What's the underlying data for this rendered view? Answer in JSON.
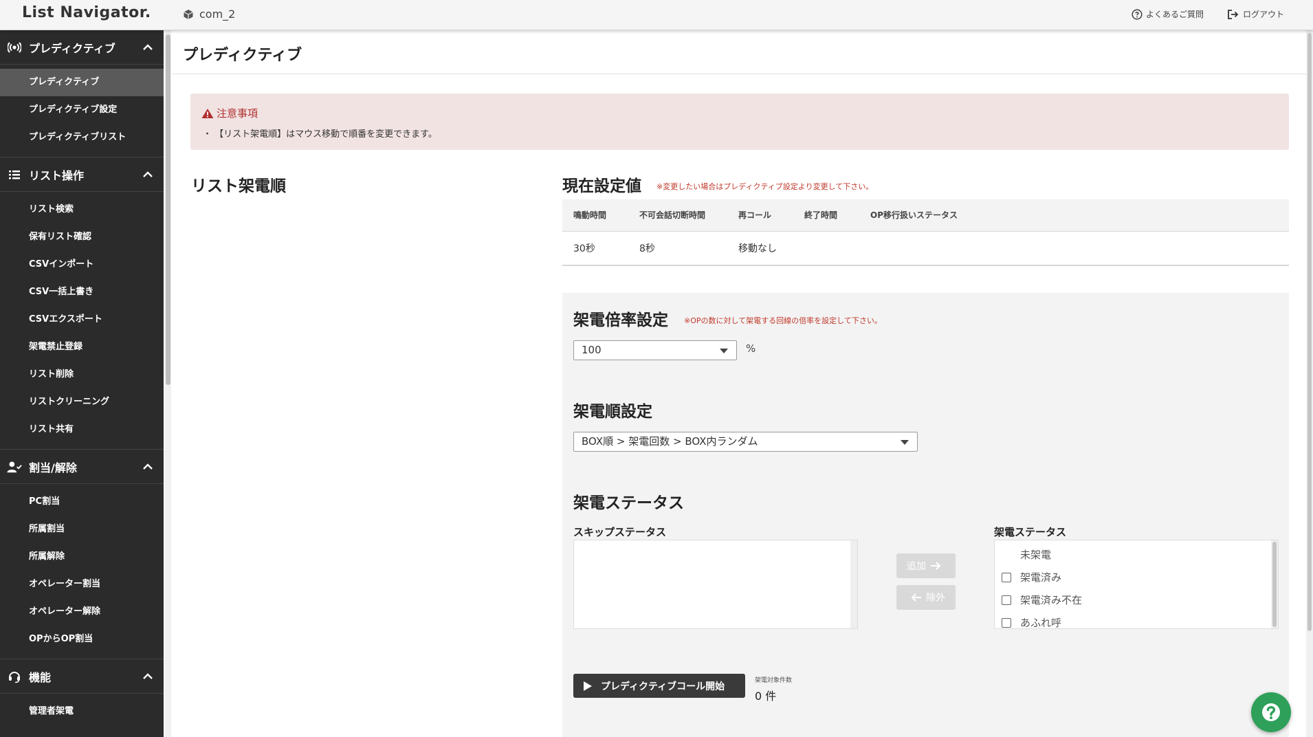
{
  "header": {
    "logo": "List Navigator.",
    "company": "com_2",
    "faq_label": "よくあるご質問",
    "logout_label": "ログアウト"
  },
  "sidebar": {
    "sections": [
      {
        "title": "プレディクティブ",
        "icon": "broadcast-icon",
        "items": [
          "プレディクティブ",
          "プレディクティブ設定",
          "プレディクティブリスト"
        ]
      },
      {
        "title": "リスト操作",
        "icon": "list-icon",
        "items": [
          "リスト検索",
          "保有リスト確認",
          "CSVインポート",
          "CSV一括上書き",
          "CSVエクスポート",
          "架電禁止登録",
          "リスト削除",
          "リストクリーニング",
          "リスト共有"
        ]
      },
      {
        "title": "割当/解除",
        "icon": "user-check-icon",
        "items": [
          "PC割当",
          "所属割当",
          "所属解除",
          "オペレーター割当",
          "オペレーター解除",
          "OPからOP割当"
        ]
      },
      {
        "title": "機能",
        "icon": "headset-icon",
        "items": [
          "管理者架電"
        ]
      }
    ]
  },
  "page": {
    "title": "プレディクティブ"
  },
  "notice": {
    "title": "注意事項",
    "text": "・ 【リスト架電順】はマウス移動で順番を変更できます。"
  },
  "list_order": {
    "title": "リスト架電順"
  },
  "current": {
    "title": "現在設定値",
    "note": "※変更したい場合はプレディクティブ設定より変更して下さい。",
    "headers": [
      "鳴動時間",
      "不可会話切断時間",
      "再コール",
      "終了時間",
      "OP移行扱いステータス"
    ],
    "values": [
      "30秒",
      "8秒",
      "移動なし",
      "",
      ""
    ]
  },
  "rate": {
    "title": "架電倍率設定",
    "note": "※OPの数に対して架電する回線の倍率を設定して下さい。",
    "value": "100",
    "unit": "%"
  },
  "order": {
    "title": "架電順設定",
    "value": "BOX順 > 架電回数 > BOX内ランダム"
  },
  "status": {
    "title": "架電ステータス",
    "skip_label": "スキップステータス",
    "call_label": "架電ステータス",
    "add_label": "追加",
    "remove_label": "除外",
    "call_items": [
      {
        "label": "未架電",
        "checkbox": false
      },
      {
        "label": "架電済み",
        "checkbox": true
      },
      {
        "label": "架電済み不在",
        "checkbox": true
      },
      {
        "label": "あふれ呼",
        "checkbox": true
      }
    ]
  },
  "start": {
    "button_label": "プレディクティブコール開始",
    "count_label": "架電対象件数",
    "count_value": "0 件"
  },
  "colors": {
    "sidebar_bg": "#2b2b2b",
    "sidebar_active": "#5a5a5a",
    "notice_bg": "#f2e3e3",
    "notice_text": "#b03030",
    "accent_green": "#2ea05a",
    "start_button": "#3a3a3a"
  }
}
